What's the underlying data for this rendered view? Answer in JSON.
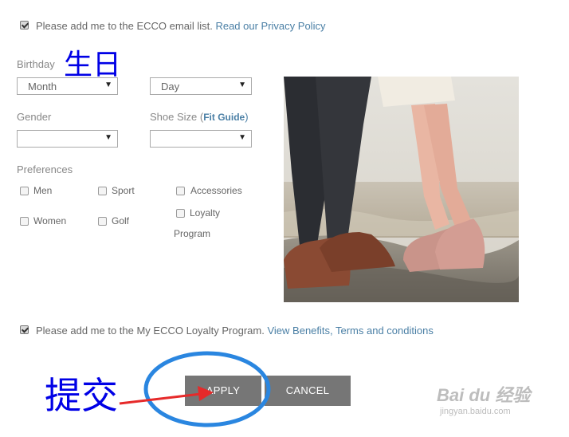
{
  "email_optin": {
    "text": "Please add me to the ECCO email list.",
    "link": "Read our Privacy Policy",
    "checked": true
  },
  "birthday": {
    "label": "Birthday",
    "month": "Month",
    "day": "Day"
  },
  "annotation_birthday": "生日",
  "gender": {
    "label": "Gender",
    "value": ""
  },
  "shoe_size": {
    "label_prefix": "Shoe Size (",
    "guide_link": "Fit Guide",
    "label_suffix": ")",
    "value": ""
  },
  "preferences": {
    "label": "Preferences",
    "items": [
      "Men",
      "Sport",
      "Accessories",
      "Women",
      "Golf",
      "Loyalty",
      "Program"
    ]
  },
  "loyalty_optin": {
    "text": "Please add me to the My ECCO Loyalty Program.",
    "link": "View Benefits, Terms and conditions",
    "checked": true
  },
  "buttons": {
    "apply": "APPLY",
    "cancel": "CANCEL"
  },
  "annotation_submit": "提交",
  "watermark": {
    "brand": "Bai du 经验",
    "url": "jingyan.baidu.com"
  },
  "colors": {
    "link": "#4a7fa5",
    "button": "#767676",
    "annotation_blue": "#0000e6",
    "arrow_red": "#e62a2a"
  }
}
